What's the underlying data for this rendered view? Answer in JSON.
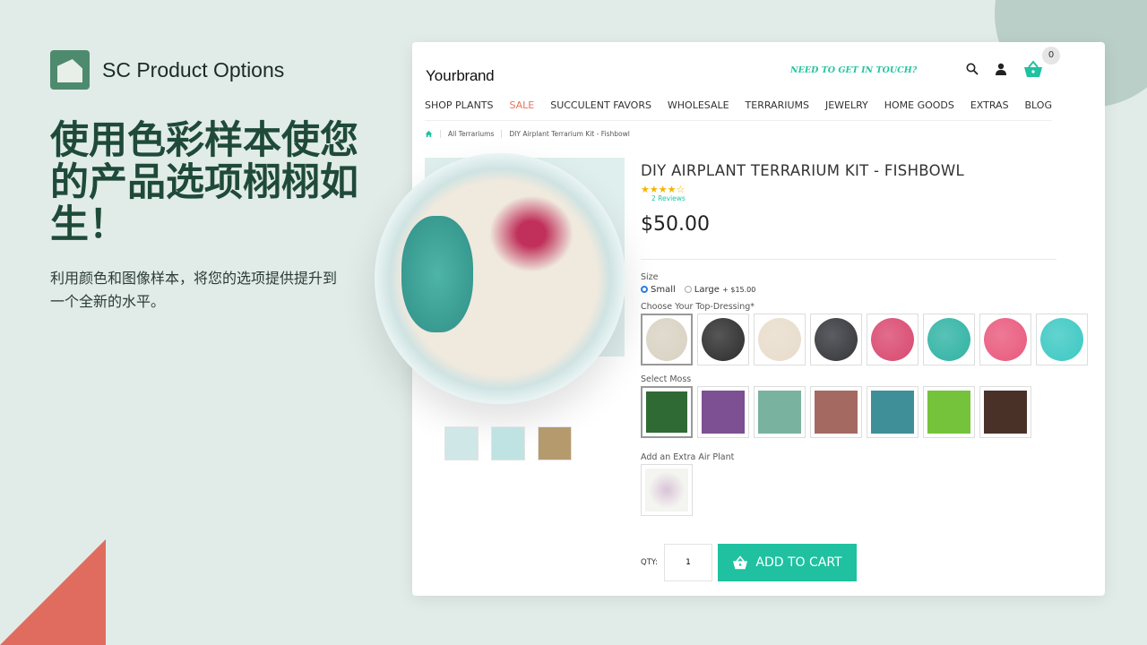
{
  "promo": {
    "app_name": "SC Product Options",
    "headline": "使用色彩样本使您的产品选项栩栩如生！",
    "subtitle": "利用颜色和图像样本，将您的选项提供提升到一个全新的水平。"
  },
  "colors": {
    "background": "#e1ece8",
    "headline": "#1f4a3a",
    "accent": "#1fc1a0",
    "coral": "#e06c60"
  },
  "store": {
    "brand_light": "Your",
    "brand_bold": "brand",
    "contact": "NEED TO GET IN TOUCH?",
    "cart_count": "0",
    "nav": [
      "SHOP PLANTS",
      "SALE",
      "SUCCULENT FAVORS",
      "WHOLESALE",
      "TERRARIUMS",
      "JEWELRY",
      "HOME GOODS",
      "EXTRAS",
      "BLOG"
    ],
    "breadcrumb": [
      "All Terrariums",
      "DIY Airplant Terrarium Kit - Fishbowl"
    ]
  },
  "product": {
    "title": "DIY AIRPLANT TERRARIUM KIT - FISHBOWL",
    "rating": 4.5,
    "stars": "★★★★☆",
    "reviews": "2 Reviews",
    "price": "$50.00",
    "size_label": "Size",
    "size_small": "Small",
    "size_large": "Large",
    "size_large_extra": "+ $15.00",
    "topdressing_label": "Choose Your Top-Dressing*",
    "topdressing": [
      "#d8d2c2",
      "#2c2c2c",
      "#e8dccb",
      "#34353a",
      "#d9486f",
      "#2fb3a3",
      "#e9587c",
      "#3cc8c3"
    ],
    "moss_label": "Select Moss",
    "moss": [
      "#2f6a35",
      "#7d4f93",
      "#79b3a0",
      "#a46a62",
      "#3e8f98",
      "#74c33a",
      "#4a3128"
    ],
    "airplant_label": "Add an Extra Air Plant",
    "qty_label": "QTY:",
    "qty_value": "1",
    "add_to_cart": "ADD TO CART"
  }
}
